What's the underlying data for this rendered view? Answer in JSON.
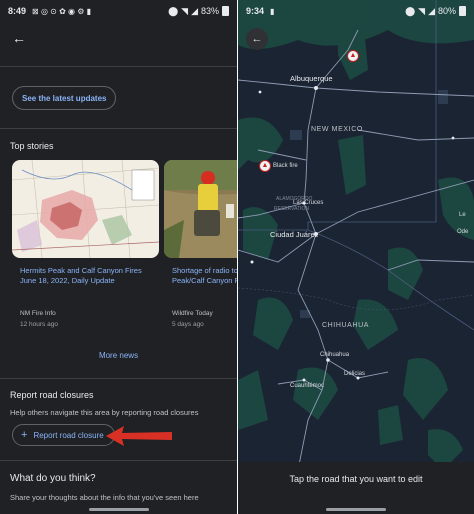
{
  "left_phone": {
    "status": {
      "time": "8:49",
      "battery": "83%"
    },
    "latest_updates_label": "See the latest updates",
    "top_stories_title": "Top stories",
    "stories": [
      {
        "title": "Hermits Peak and Calf Canyon Fires June 18, 2022, Daily Update",
        "source": "NM Fire Info",
        "time": "12 hours ago"
      },
      {
        "title": "Shortage of radio to have compromised Peak/Calf Canyon Fire",
        "source": "Wildfire Today",
        "time": "5 days ago"
      }
    ],
    "more_news_label": "More news",
    "road_closures": {
      "title": "Report road closures",
      "subtitle": "Help others navigate this area by reporting road closures",
      "button_label": "Report road closure"
    },
    "feedback": {
      "title": "What do you think?",
      "subtitle": "Share your thoughts about the info that you've seen here"
    }
  },
  "right_phone": {
    "status": {
      "time": "9:34",
      "battery": "80%"
    },
    "map_labels": {
      "albuquerque": "Albuquerque",
      "new_mexico": "NEW MEXICO",
      "black_fire": "Black fire",
      "las_cruces": "Las Cruces",
      "ciudad_juarez": "Ciudad Juárez",
      "chihuahua_state": "CHIHUAHUA",
      "chihuahua_city": "Chihuahua",
      "cuauhtemoc": "Cuauhtémoc",
      "delicias": "Delicias",
      "alamogordo": "ALAMOGORDO",
      "reservation": "RESERVATION",
      "truncated_city": "Ode",
      "truncated_city_2": "Le"
    },
    "edit_prompt": "Tap the road that you want to edit"
  },
  "colors": {
    "accent": "#8ab4f8",
    "background": "#202124",
    "arrow": "#d93025",
    "map_land": "#1b2433",
    "map_green": "#1d4a42"
  },
  "icons": [
    "back-arrow-icon",
    "plus-icon",
    "fire-icon",
    "battery-icon",
    "wifi-icon",
    "signal-icon"
  ]
}
